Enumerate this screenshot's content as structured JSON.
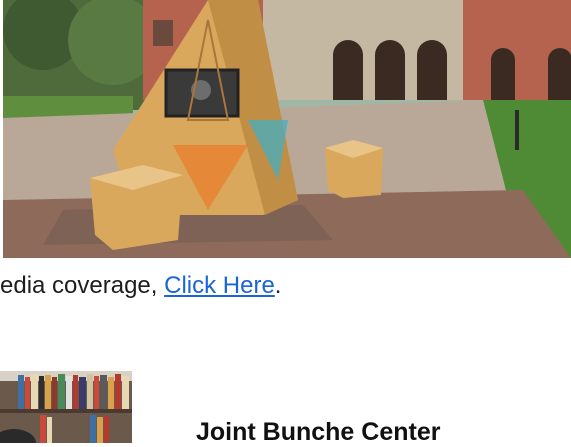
{
  "hero_image": {
    "icon": "kiosk-photo",
    "caption_visible": false
  },
  "coverage": {
    "prefix": "edia coverage, ",
    "link_label": "Click Here",
    "suffix": "."
  },
  "thumbnail": {
    "icon": "bookshelf-photo"
  },
  "section": {
    "heading": "Joint Bunche Center"
  },
  "colors": {
    "link": "#1a64d6",
    "text": "#1d1d1d",
    "heading": "#111111"
  }
}
